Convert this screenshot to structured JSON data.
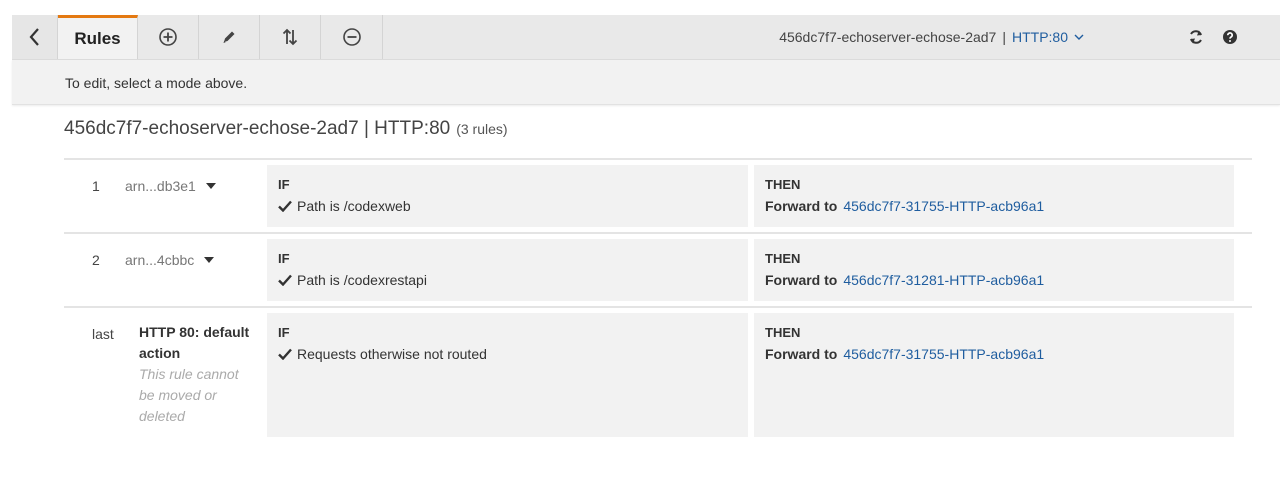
{
  "toolbar": {
    "rules_tab": "Rules",
    "lb_name": "456dc7f7-echoserver-echose-2ad7",
    "separator": "|",
    "listener": "HTTP:80"
  },
  "infobar": {
    "message": "To edit, select a mode above."
  },
  "heading": {
    "title": "456dc7f7-echoserver-echose-2ad7 | HTTP:80",
    "count": "(3 rules)"
  },
  "rules": [
    {
      "number": "1",
      "arn": "arn...db3e1",
      "if_title": "IF",
      "condition": "Path is /codexweb",
      "then_title": "THEN",
      "action_label": "Forward to",
      "target": "456dc7f7-31755-HTTP-acb96a1"
    },
    {
      "number": "2",
      "arn": "arn...4cbbc",
      "if_title": "IF",
      "condition": "Path is /codexrestapi",
      "then_title": "THEN",
      "action_label": "Forward to",
      "target": "456dc7f7-31281-HTTP-acb96a1"
    },
    {
      "number": "last",
      "default_label": "HTTP 80: default action",
      "default_note": "This rule cannot be moved or deleted",
      "if_title": "IF",
      "condition": "Requests otherwise not routed",
      "then_title": "THEN",
      "action_label": "Forward to",
      "target": "456dc7f7-31755-HTTP-acb96a1"
    }
  ],
  "colors": {
    "accent": "#e47911",
    "link": "#1f5d9f",
    "toolbar_bg": "#e9e9e9",
    "panel_bg": "#f2f2f2"
  },
  "icons": [
    "back-chevron-icon",
    "add-circle-icon",
    "pencil-icon",
    "reorder-arrows-icon",
    "remove-circle-icon",
    "chevron-down-icon",
    "refresh-icon",
    "help-icon",
    "caret-down-icon",
    "checkmark-icon"
  ]
}
